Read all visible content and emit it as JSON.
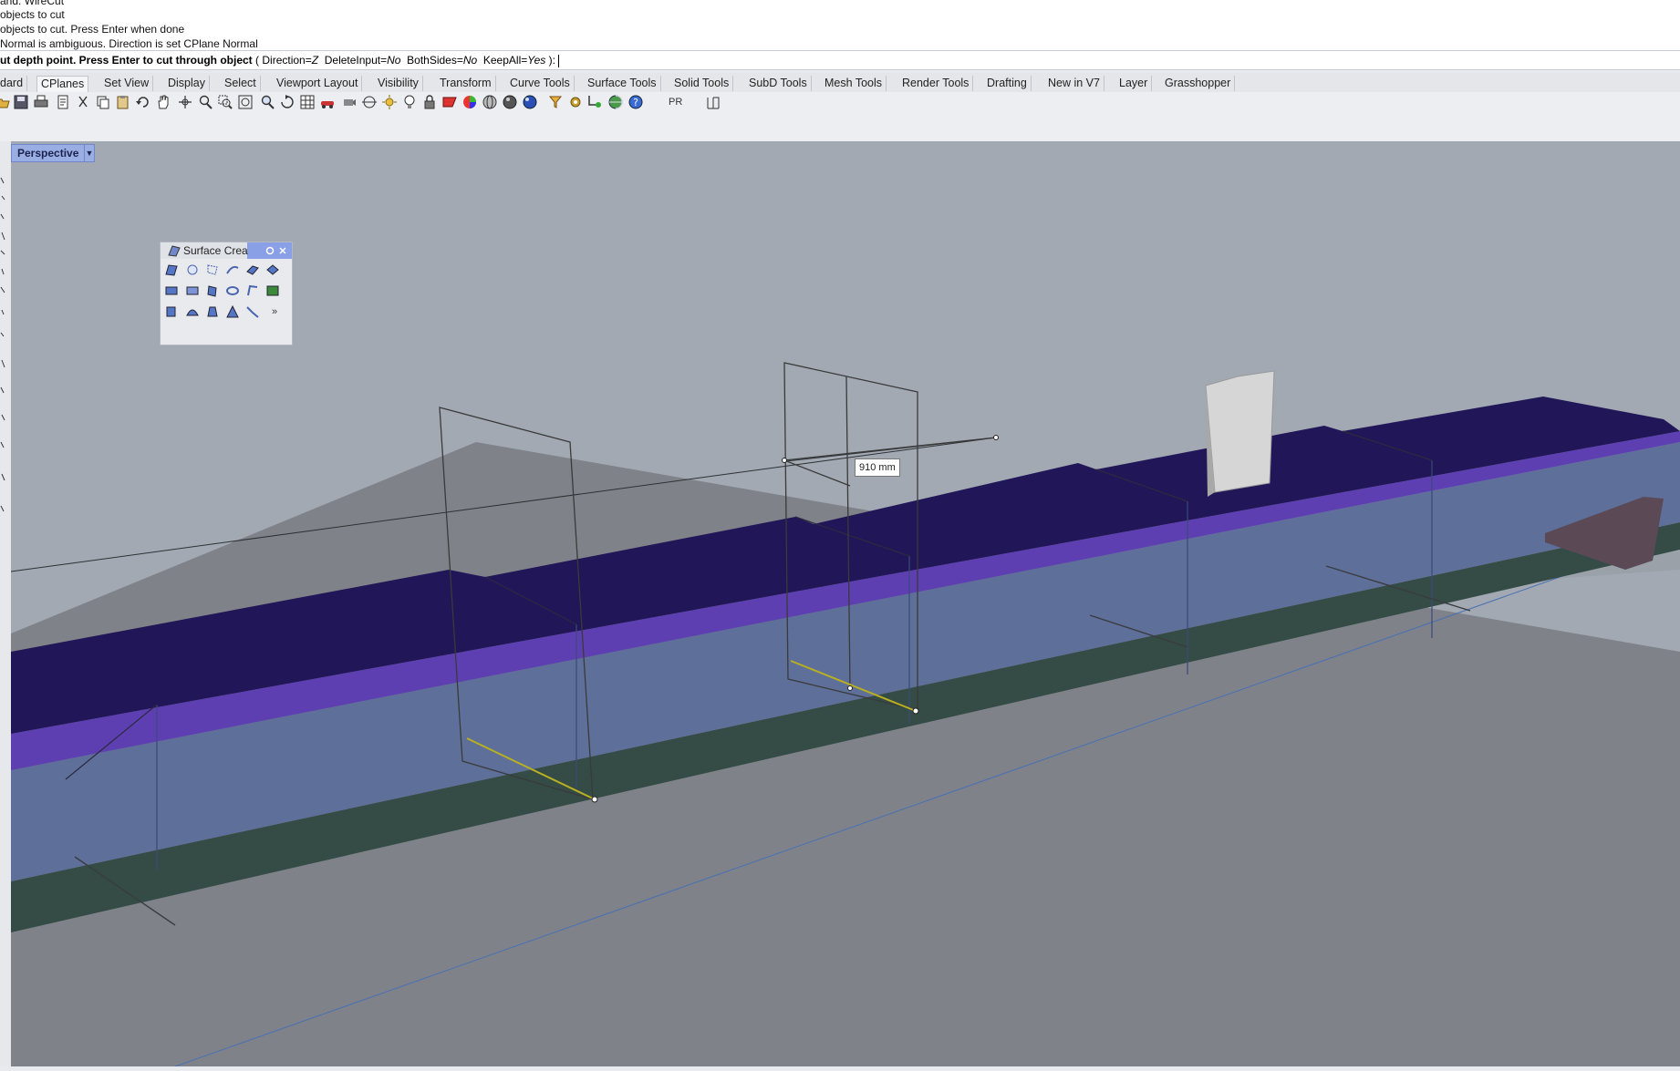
{
  "command_history": [
    "and: WireCut",
    "objects to cut",
    "objects to cut. Press Enter when done",
    "Normal is ambiguous. Direction is set CPlane Normal"
  ],
  "command_prompt": {
    "main": "ut depth point. Press Enter to cut through object",
    "options_open": "( ",
    "opt_direction": "Direction=",
    "opt_direction_val": "Z",
    "opt_deleteinput": "DeleteInput=",
    "opt_deleteinput_val": "No",
    "opt_bothsides": "BothSides=",
    "opt_bothsides_val": "No",
    "opt_keepall": "KeepAll=",
    "opt_keepall_val": "Yes",
    "options_close": " ):"
  },
  "tabs": [
    "dard",
    "CPlanes",
    "Set View",
    "Display",
    "Select",
    "Viewport Layout",
    "Visibility",
    "Transform",
    "Curve Tools",
    "Surface Tools",
    "Solid Tools",
    "SubD Tools",
    "Mesh Tools",
    "Render Tools",
    "Drafting",
    "New in V7",
    "Layer",
    "Grasshopper"
  ],
  "toolbar": {
    "pr_label": "PR"
  },
  "viewport": {
    "name": "Perspective",
    "dimension_label": "910 mm"
  },
  "floating_panel": {
    "title": "Surface Crea",
    "more_glyph": "»"
  },
  "colors": {
    "wall_top": "#211657",
    "wall_front": "#5e6f9a",
    "wall_trim": "#5e3fb1",
    "base": "#354c46",
    "ground": "#7f8389",
    "sky": "#a2a9b2",
    "cut_line": "#b8b020"
  }
}
